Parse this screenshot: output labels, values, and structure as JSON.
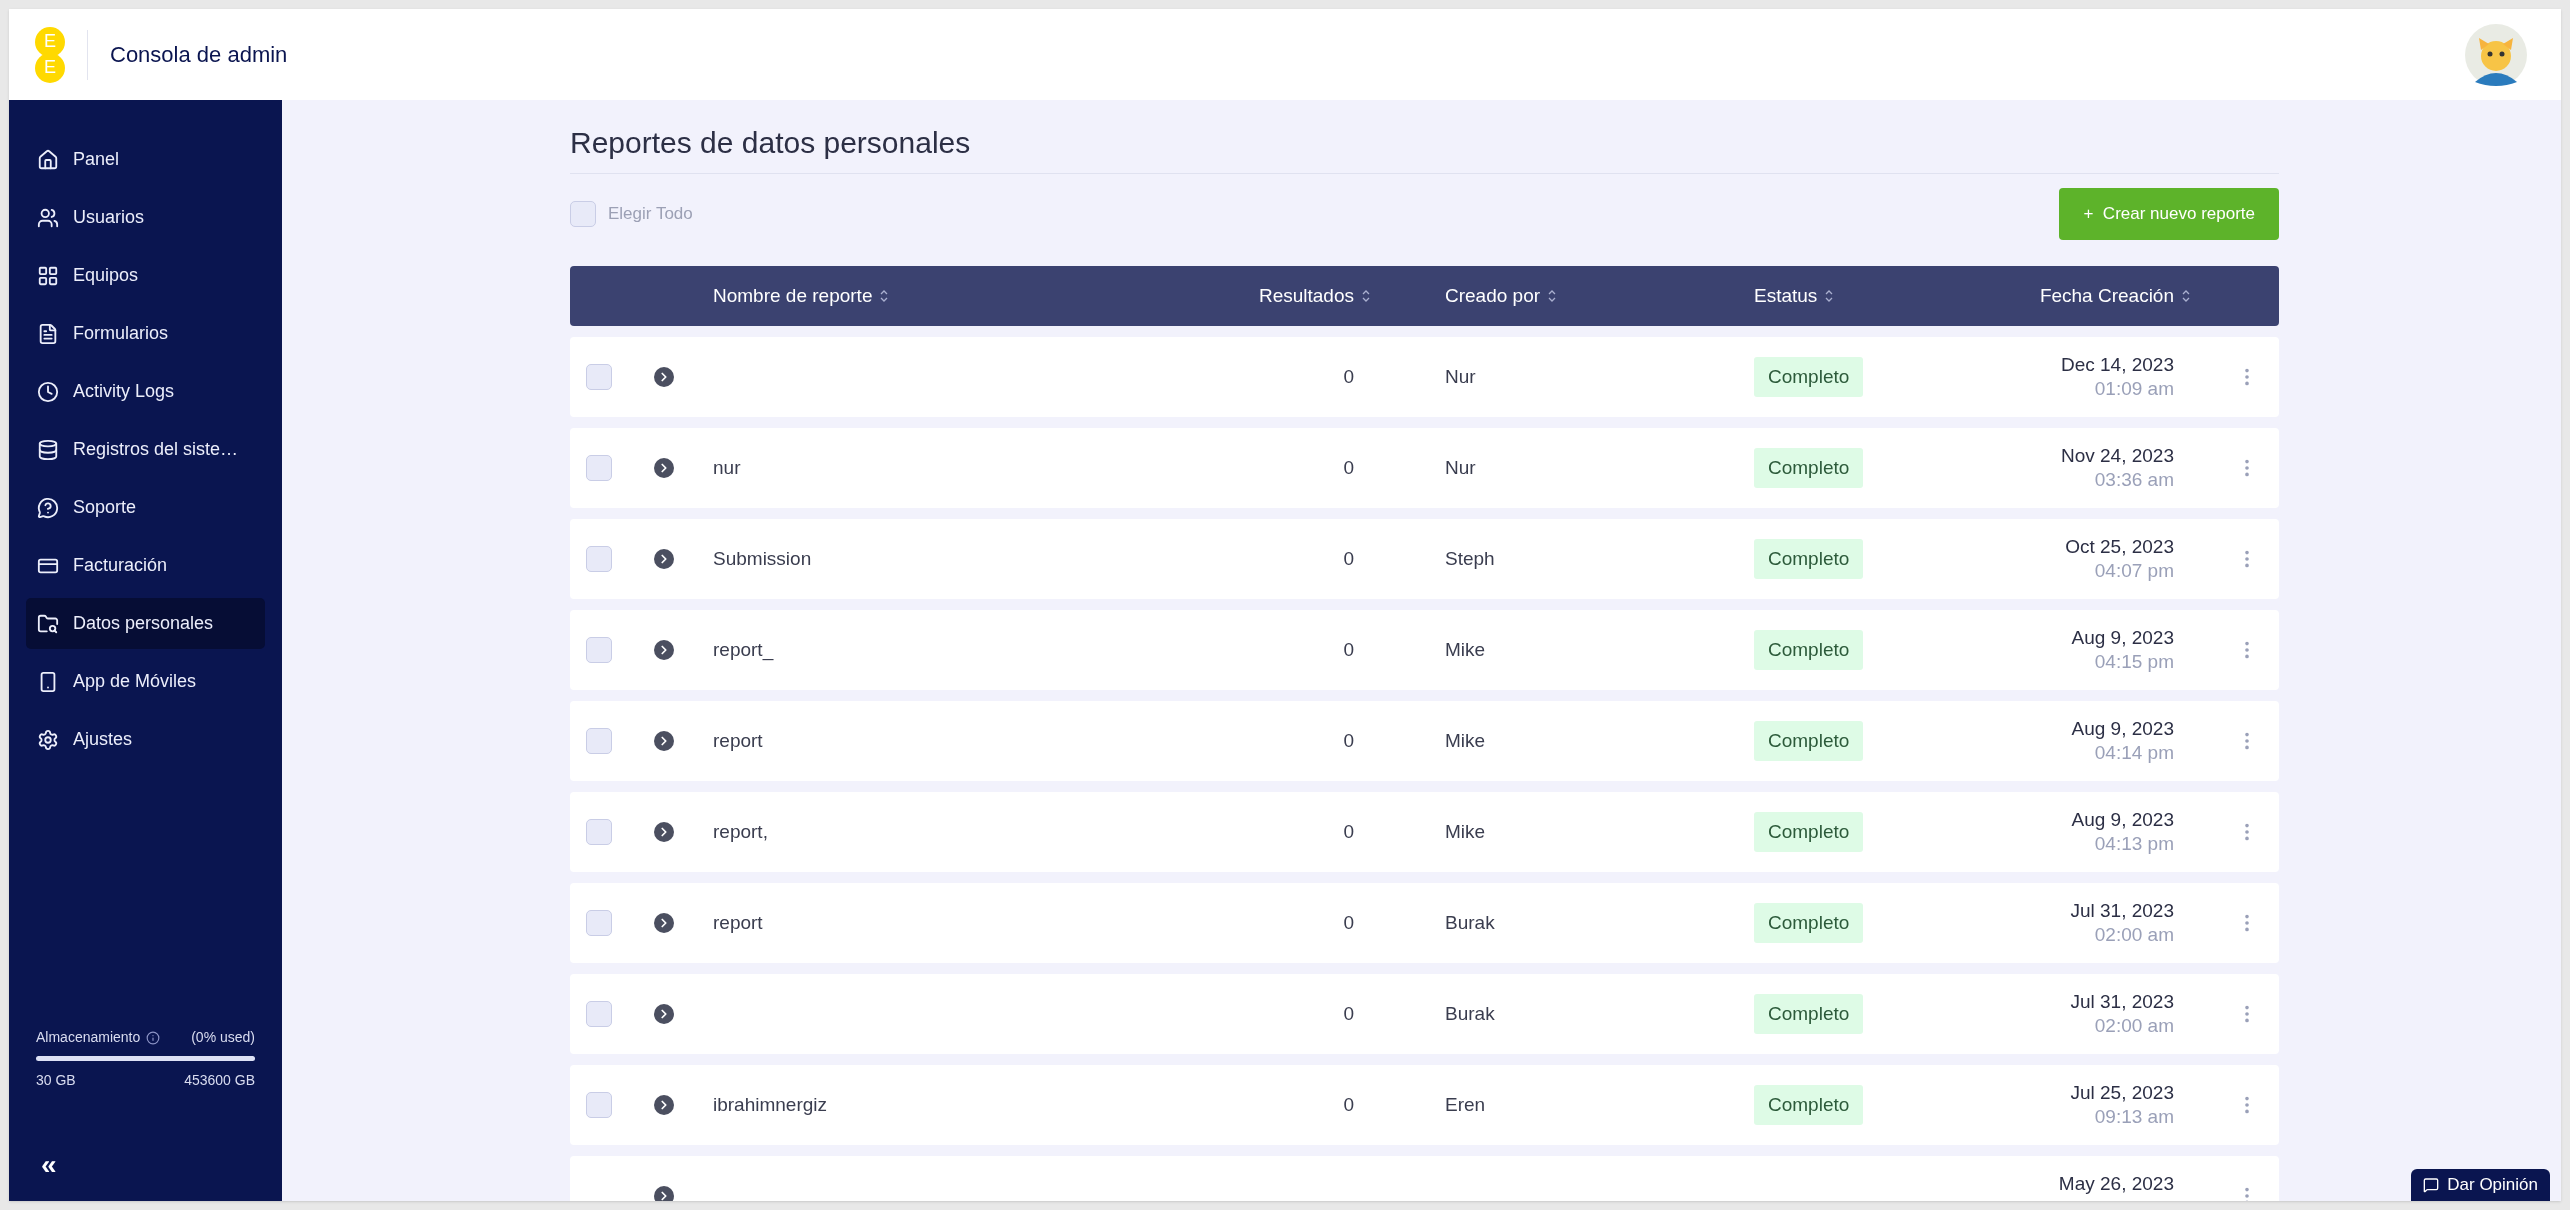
{
  "header": {
    "logo_letters": [
      "E",
      "E"
    ],
    "title": "Consola de admin"
  },
  "sidebar": {
    "items": [
      {
        "label": "Panel",
        "selected": false
      },
      {
        "label": "Usuarios",
        "selected": false
      },
      {
        "label": "Equipos",
        "selected": false
      },
      {
        "label": "Formularios",
        "selected": false
      },
      {
        "label": "Activity Logs",
        "selected": false
      },
      {
        "label": "Registros del siste…",
        "selected": false
      },
      {
        "label": "Soporte",
        "selected": false
      },
      {
        "label": "Facturación",
        "selected": false
      },
      {
        "label": "Datos personales",
        "selected": true
      },
      {
        "label": "App de Móviles",
        "selected": false
      },
      {
        "label": "Ajustes",
        "selected": false
      }
    ],
    "storage": {
      "label": "Almacenamiento",
      "usage": "(0% used)",
      "level": 0,
      "used": "30 GB",
      "total": "453600 GB"
    },
    "collapse": "«"
  },
  "page": {
    "title": "Reportes de datos personales",
    "select_all": {
      "label": "Elegir Todo",
      "checked": false
    },
    "create_button": "+  Crear nuevo reporte"
  },
  "table": {
    "columns": [
      "Nombre de reporte",
      "Resultados",
      "Creado por",
      "Estatus",
      "Fecha Creación"
    ],
    "rows": [
      {
        "checked": false,
        "name": "",
        "results": "0",
        "creator": "Nur",
        "status": "Completo",
        "date": "Dec 14, 2023",
        "time": "01:09 am"
      },
      {
        "checked": false,
        "name": "nur",
        "results": "0",
        "creator": "Nur",
        "status": "Completo",
        "date": "Nov 24, 2023",
        "time": "03:36 am"
      },
      {
        "checked": false,
        "name": "Submission",
        "results": "0",
        "creator": "Steph",
        "status": "Completo",
        "date": "Oct 25, 2023",
        "time": "04:07 pm"
      },
      {
        "checked": false,
        "name": "report_",
        "results": "0",
        "creator": "Mike",
        "status": "Completo",
        "date": "Aug 9, 2023",
        "time": "04:15 pm"
      },
      {
        "checked": false,
        "name": "report",
        "results": "0",
        "creator": "Mike",
        "status": "Completo",
        "date": "Aug 9, 2023",
        "time": "04:14 pm"
      },
      {
        "checked": false,
        "name": "report,",
        "results": "0",
        "creator": "Mike",
        "status": "Completo",
        "date": "Aug 9, 2023",
        "time": "04:13 pm"
      },
      {
        "checked": false,
        "name": "report",
        "results": "0",
        "creator": "Burak",
        "status": "Completo",
        "date": "Jul 31, 2023",
        "time": "02:00 am"
      },
      {
        "checked": false,
        "name": "",
        "results": "0",
        "creator": "Burak",
        "status": "Completo",
        "date": "Jul 31, 2023",
        "time": "02:00 am"
      },
      {
        "checked": false,
        "name": "ibrahimnergiz",
        "results": "0",
        "creator": "Eren",
        "status": "Completo",
        "date": "Jul 25, 2023",
        "time": "09:13 am"
      },
      {
        "name": "",
        "results": "",
        "creator": "",
        "status": "",
        "date": "May 26, 2023",
        "time": ""
      }
    ]
  },
  "feedback_button": "Dar Opinión"
}
